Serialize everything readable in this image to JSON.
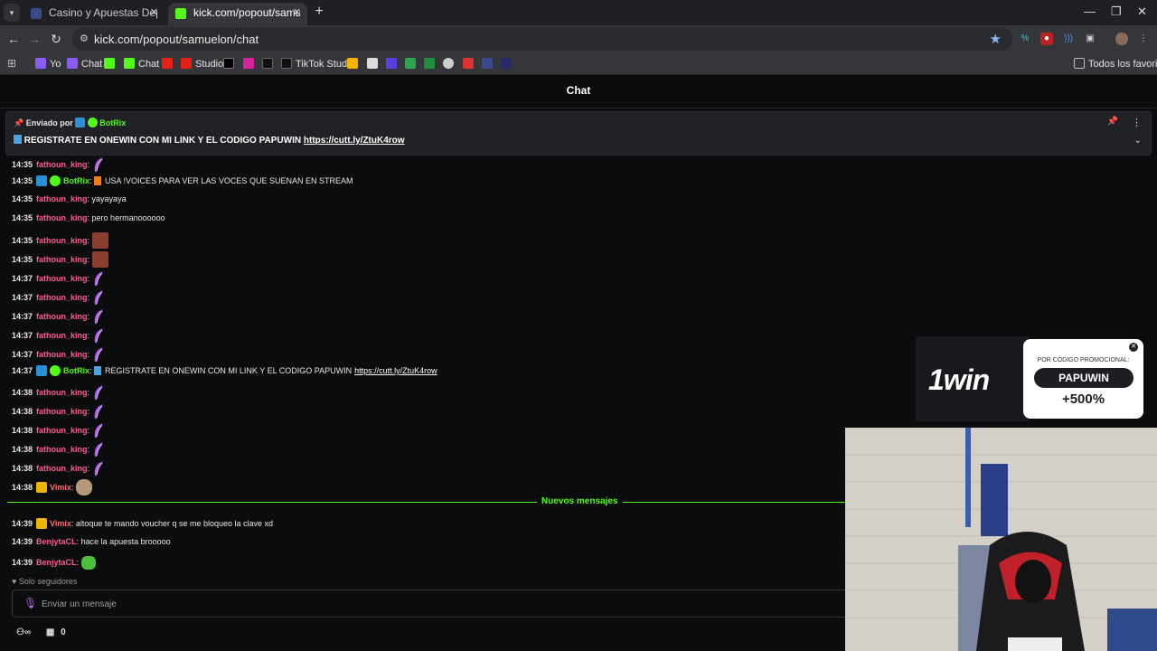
{
  "browser": {
    "tabs": [
      {
        "title": "Casino y Apuestas Deportivas C",
        "active": false
      },
      {
        "title": "kick.com/popout/samuelon/ch",
        "active": true
      }
    ],
    "url": "kick.com/popout/samuelon/chat",
    "bookmarks": [
      "Yo",
      "Chat",
      "Chat",
      "Studio",
      "TikTok Studio"
    ],
    "all_bookmarks_label": "Todos los favoritos"
  },
  "chat": {
    "title": "Chat",
    "pinned": {
      "sent_by_label": "Enviado por",
      "bot_name": "BotRix",
      "message": "REGISTRATE EN ONEWIN CON MI LINK Y EL CODIGO PAPUWIN",
      "link": "https://cutt.ly/ZtuK4row"
    },
    "messages": [
      {
        "time": "14:35",
        "user": "fathoun_king",
        "text": "",
        "emote": "feather"
      },
      {
        "time": "14:35",
        "user": "BotRix",
        "text": "USA !VOICES PARA VER LAS VOCES QUE SUENAN EN STREAM",
        "emote": ""
      },
      {
        "time": "14:35",
        "user": "fathoun_king",
        "text": "yayayaya",
        "emote": ""
      },
      {
        "time": "14:35",
        "user": "fathoun_king",
        "text": "pero hermanoooooo",
        "emote": ""
      },
      {
        "time": "14:35",
        "user": "fathoun_king",
        "text": "",
        "emote": "face"
      },
      {
        "time": "14:35",
        "user": "fathoun_king",
        "text": "",
        "emote": "face"
      },
      {
        "time": "14:37",
        "user": "fathoun_king",
        "text": "",
        "emote": "feather"
      },
      {
        "time": "14:37",
        "user": "fathoun_king",
        "text": "",
        "emote": "feather"
      },
      {
        "time": "14:37",
        "user": "fathoun_king",
        "text": "",
        "emote": "feather"
      },
      {
        "time": "14:37",
        "user": "fathoun_king",
        "text": "",
        "emote": "feather"
      },
      {
        "time": "14:37",
        "user": "fathoun_king",
        "text": "",
        "emote": "feather"
      },
      {
        "time": "14:37",
        "user": "BotRix",
        "text": "REGISTRATE EN ONEWIN CON MI LINK Y EL CODIGO PAPUWIN",
        "link": "https://cutt.ly/ZtuK4row",
        "emote": ""
      },
      {
        "time": "14:38",
        "user": "fathoun_king",
        "text": "",
        "emote": "feather"
      },
      {
        "time": "14:38",
        "user": "fathoun_king",
        "text": "",
        "emote": "feather"
      },
      {
        "time": "14:38",
        "user": "fathoun_king",
        "text": "",
        "emote": "feather"
      },
      {
        "time": "14:38",
        "user": "fathoun_king",
        "text": "",
        "emote": "feather"
      },
      {
        "time": "14:38",
        "user": "fathoun_king",
        "text": "",
        "emote": "feather"
      },
      {
        "time": "14:38",
        "user": "Vimix",
        "text": "",
        "emote": "cat"
      }
    ],
    "new_messages_label": "Nuevos mensajes",
    "new_messages": [
      {
        "time": "14:39",
        "user": "Vimix",
        "text": "altoque te mando voucher q se me bloqueo la clave xd",
        "emote": ""
      },
      {
        "time": "14:39",
        "user": "BenjytaCL",
        "text": "hace la apuesta brooooo",
        "emote": ""
      },
      {
        "time": "14:39",
        "user": "BenjytaCL",
        "text": "",
        "emote": "frog"
      }
    ],
    "followers_only_label": "Solo seguidores",
    "input_placeholder": "Enviar un mensaje",
    "footer_count": "0"
  },
  "promo": {
    "brand": "1win",
    "label": "POR CÓDIGO PROMOCIONAL:",
    "code": "PAPUWIN",
    "bonus": "+500%"
  },
  "colors": {
    "kick_green": "#53fc18",
    "user_pink": "#ff5c8a",
    "user_vimix": "#ff6b6b",
    "bot_green": "#53fc18"
  }
}
